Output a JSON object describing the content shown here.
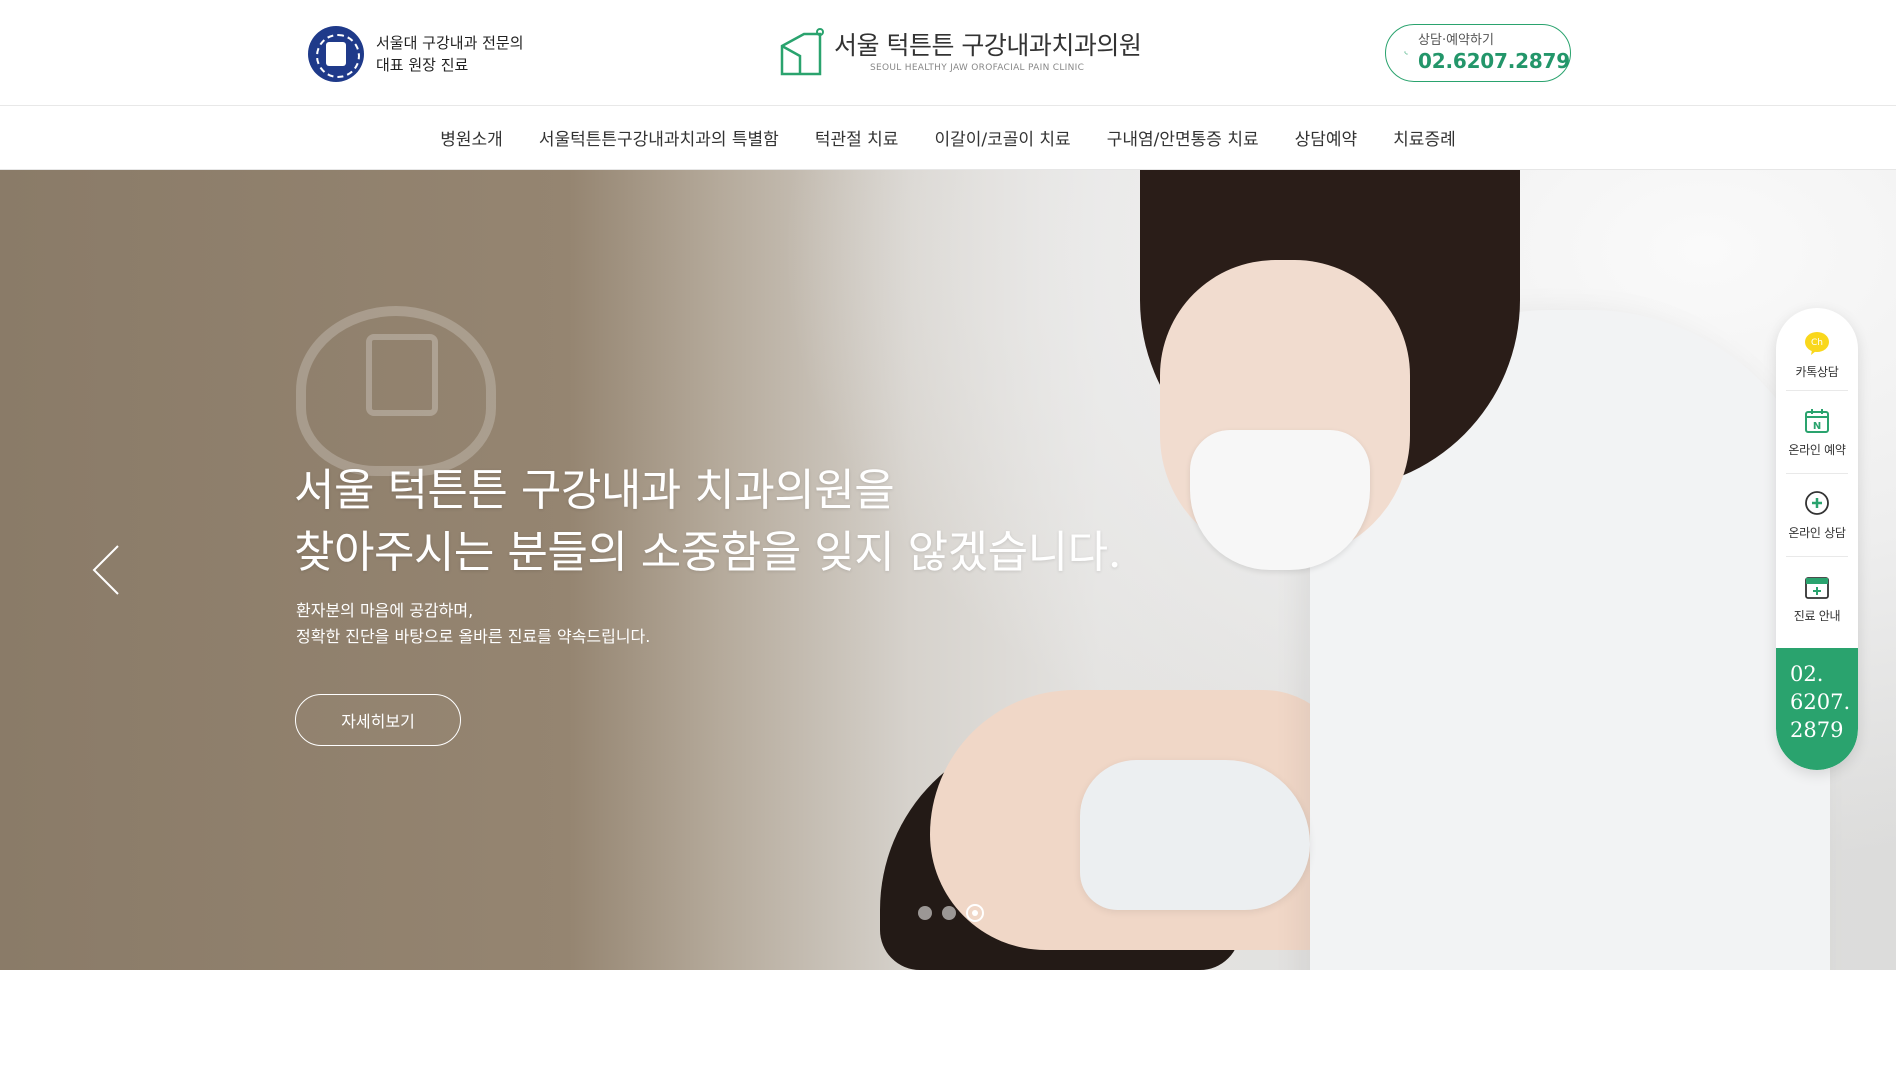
{
  "header": {
    "univ_text_line1": "서울대 구강내과 전문의",
    "univ_text_line2": "대표 원장 진료",
    "brand_name": "서울 턱튼튼 구강내과치과의원",
    "brand_sub": "SEOUL HEALTHY JAW OROFACIAL PAIN CLINIC",
    "call_label": "상담·예약하기",
    "call_number": "02.6207.2879"
  },
  "nav": {
    "items": [
      {
        "label": "병원소개"
      },
      {
        "label": "서울턱튼튼구강내과치과의 특별함"
      },
      {
        "label": "턱관절 치료"
      },
      {
        "label": "이갈이/코골이 치료"
      },
      {
        "label": "구내염/안면통증 치료"
      },
      {
        "label": "상담예약"
      },
      {
        "label": "치료증례"
      }
    ]
  },
  "hero": {
    "title_line1": "서울 턱튼튼 구강내과 치과의원을",
    "title_line2": "찾아주시는 분들의 소중함을 잊지 않겠습니다.",
    "desc_line1": "환자분의 마음에 공감하며,",
    "desc_line2": "정확한 진단을 바탕으로 올바른 진료를 약속드립니다.",
    "button_label": "자세히보기",
    "slides_total": 3,
    "slide_active": 3
  },
  "quick_menu": {
    "items": [
      {
        "label": "카톡상담",
        "icon": "kakao-chat-icon"
      },
      {
        "label": "온라인 예약",
        "icon": "calendar-n-icon"
      },
      {
        "label": "온라인 상담",
        "icon": "plus-chat-icon"
      },
      {
        "label": "진료 안내",
        "icon": "calendar-plus-icon"
      }
    ],
    "phone_line1": "02.",
    "phone_line2": "6207.",
    "phone_line3": "2879"
  },
  "colors": {
    "accent_green": "#2aa36e",
    "brand_navy": "#1f3a8a",
    "kakao_yellow": "#f9d71c"
  }
}
